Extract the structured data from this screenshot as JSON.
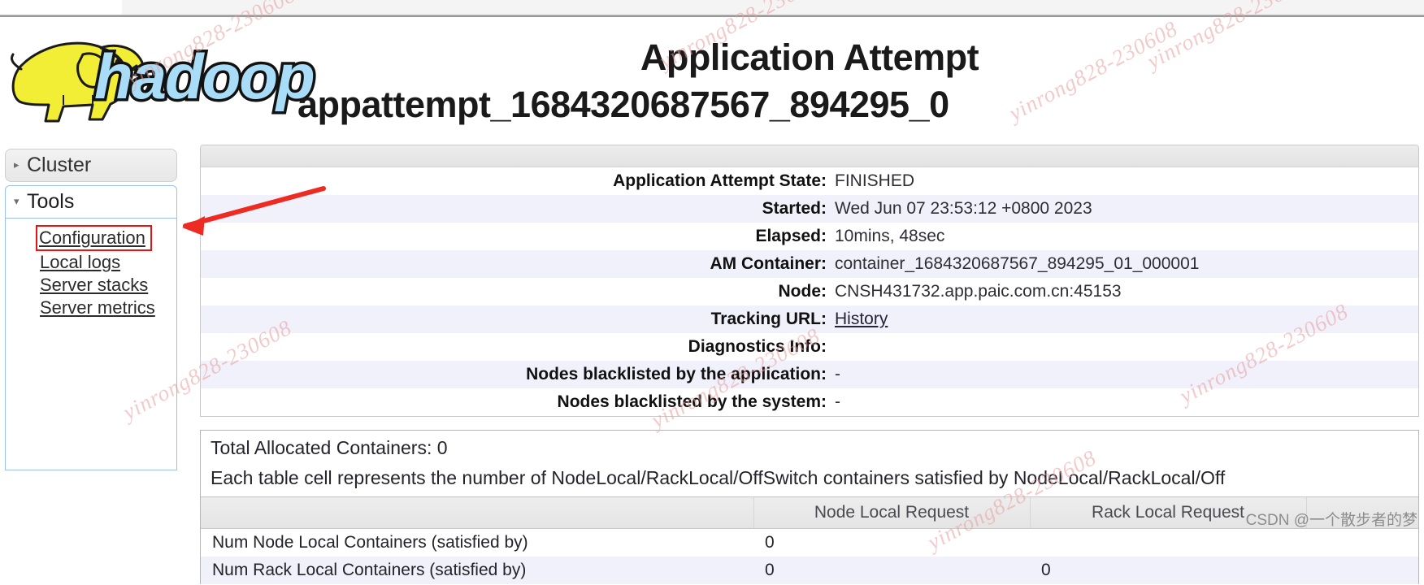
{
  "browser": {
    "tab_strip_color": "#f4f4f5"
  },
  "header": {
    "logo_name": "hadoop-logo",
    "logo_word": "hadoop",
    "title_line1": "Application Attempt",
    "title_line2": "appattempt_1684320687567_894295_0"
  },
  "sidebar": {
    "groups": [
      {
        "label": "Cluster",
        "expanded": false,
        "caret": "▸"
      },
      {
        "label": "Tools",
        "expanded": true,
        "caret": "▾"
      }
    ],
    "tools_links": [
      {
        "label": "Configuration",
        "highlighted": true
      },
      {
        "label": "Local logs",
        "highlighted": false
      },
      {
        "label": "Server stacks",
        "highlighted": false
      },
      {
        "label": "Server metrics",
        "highlighted": false
      }
    ],
    "highlight_color": "#e81313"
  },
  "attempt_details": {
    "rows": [
      {
        "key": "Application Attempt State:",
        "value": "FINISHED",
        "link": false
      },
      {
        "key": "Started:",
        "value": "Wed Jun 07 23:53:12 +0800 2023",
        "link": false
      },
      {
        "key": "Elapsed:",
        "value": "10mins, 48sec",
        "link": false
      },
      {
        "key": "AM Container:",
        "value": "container_1684320687567_894295_01_000001",
        "link": false
      },
      {
        "key": "Node:",
        "value": "CNSH431732.app.paic.com.cn:45153",
        "link": false
      },
      {
        "key": "Tracking URL:",
        "value": "History",
        "link": true
      },
      {
        "key": "Diagnostics Info:",
        "value": "",
        "link": false
      },
      {
        "key": "Nodes blacklisted by the application:",
        "value": "-",
        "link": false
      },
      {
        "key": "Nodes blacklisted by the system:",
        "value": "-",
        "link": false
      }
    ]
  },
  "containers_section": {
    "total_allocated": "Total Allocated Containers: 0",
    "description": "Each table cell represents the number of NodeLocal/RackLocal/OffSwitch containers satisfied by NodeLocal/RackLocal/Off",
    "columns": [
      "",
      "Node Local Request",
      "Rack Local Request"
    ],
    "rows": [
      {
        "label": "Num Node Local Containers (satisfied by)",
        "node_local": "0",
        "rack_local": ""
      },
      {
        "label": "Num Rack Local Containers (satisfied by)",
        "node_local": "0",
        "rack_local": "0"
      }
    ]
  },
  "annotation": {
    "arrow_color": "#ee2b22",
    "arrow_target": "configuration-link"
  },
  "watermarks": {
    "text": "yinrong828-230608",
    "csdn": "CSDN @一个散步者的梦"
  }
}
